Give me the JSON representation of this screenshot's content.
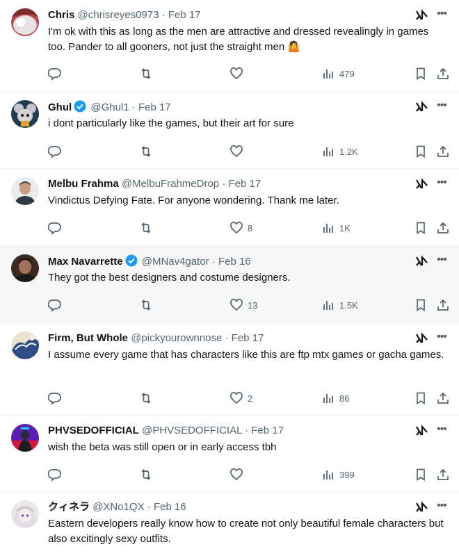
{
  "replies": [
    {
      "name": "Chris",
      "handle": "@chrisreyes0973",
      "separator": "·",
      "date": "Feb 17",
      "verified": false,
      "text": "I'm ok with this as long as the men are attractive and dressed revealingly in games too. Pander to all gooners, not just the straight men 🤷",
      "likes": "",
      "views": "479"
    },
    {
      "name": "Ghul",
      "handle": "@Ghul1",
      "separator": "·",
      "date": "Feb 17",
      "verified": true,
      "text": "i dont particularly like the games, but their art for sure",
      "likes": "",
      "views": "1.2K"
    },
    {
      "name": "Melbu Frahma",
      "handle": "@MelbuFrahmeDrop",
      "separator": "·",
      "date": "Feb 17",
      "verified": false,
      "text": "Vindictus Defying Fate. For anyone wondering. Thank me later.",
      "likes": "8",
      "views": "1K"
    },
    {
      "name": "Max Navarrette",
      "handle": "@MNav4gator",
      "separator": "·",
      "date": "Feb 16",
      "verified": true,
      "text": "They got the best designers and costume designers.",
      "likes": "13",
      "views": "1.5K"
    },
    {
      "name": "Firm, But Whole",
      "handle": "@pickyourownnose",
      "separator": "·",
      "date": "Feb 17",
      "verified": false,
      "text": "I assume every game that has characters like this are ftp mtx games or gacha games.",
      "likes": "2",
      "views": "86"
    },
    {
      "name": "PHVSEDOFFICIAL",
      "handle": "@PHVSEDOFFICIAL",
      "separator": "·",
      "date": "Feb 17",
      "verified": false,
      "text": "wish the beta was still open or in early access tbh",
      "likes": "",
      "views": "399"
    },
    {
      "name": "クィネラ",
      "handle": "@XNo1QX",
      "separator": "·",
      "date": "Feb 16",
      "verified": false,
      "text": "Eastern developers really know how to create not only beautiful female characters but also excitingly sexy outfits.",
      "likes": "",
      "views": ""
    }
  ],
  "icons": {
    "reply": "reply-icon",
    "repost": "repost-icon",
    "like": "heart-icon",
    "views": "views-icon",
    "bookmark": "bookmark-icon",
    "share": "share-icon",
    "grok": "grok-icon",
    "more": "more-icon",
    "verified": "verified-badge-icon"
  },
  "colors": {
    "text": "#0f1419",
    "secondary": "#536471",
    "verified": "#1d9bf0",
    "divider": "#eff3f4",
    "hover": "#f7f7f7"
  }
}
